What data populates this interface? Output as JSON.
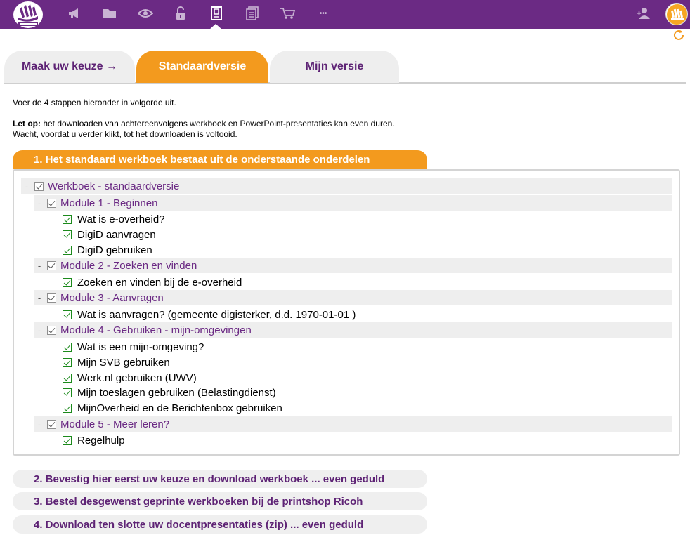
{
  "nav": {
    "icons": [
      "megaphone-icon",
      "folder-icon",
      "eye-icon",
      "unlock-icon",
      "book-icon",
      "documents-icon",
      "cart-icon",
      "more-icon"
    ],
    "more_label": "•••"
  },
  "tabs": [
    {
      "label": "Maak uw keuze →"
    },
    {
      "label": "Standaardversie"
    },
    {
      "label": "Mijn versie"
    }
  ],
  "intro": {
    "line1": "Voer de 4 stappen hieronder in volgorde uit.",
    "note_prefix": "Let op:",
    "note_text": " het downloaden van achtereenvolgens werkboek en PowerPoint-presentaties kan even duren.",
    "note_line2": "Wacht, voordat u verder klikt, tot het downloaden is voltooid."
  },
  "steps": {
    "step1": "1. Het standaard werkboek bestaat uit de onderstaande onderdelen",
    "step2": "2. Bevestig hier eerst uw keuze en download werkboek ... even geduld",
    "step3": "3. Bestel desgewenst geprinte werkboeken bij de printshop Ricoh",
    "step4": "4. Download ten slotte uw docentpresentaties (zip) ... even geduld"
  },
  "tree": {
    "toggle": "-",
    "root": "Werkboek - standaardversie",
    "modules": [
      {
        "label": "Module 1 - Beginnen",
        "items": [
          "Wat is e-overheid?",
          "DigiD aanvragen",
          "DigiD gebruiken"
        ]
      },
      {
        "label": "Module 2 - Zoeken en vinden",
        "items": [
          "Zoeken en vinden bij de e-overheid"
        ]
      },
      {
        "label": "Module 3 - Aanvragen",
        "items": [
          "Wat is aanvragen? (gemeente digisterker, d.d. 1970-01-01 )"
        ]
      },
      {
        "label": "Module 4 - Gebruiken - mijn-omgevingen",
        "items": [
          "Wat is een mijn-omgeving?",
          "Mijn SVB gebruiken",
          "Werk.nl gebruiken (UWV)",
          "Mijn toeslagen gebruiken (Belastingdienst)",
          "MijnOverheid en de Berichtenbox gebruiken"
        ]
      },
      {
        "label": "Module 5 - Meer leren?",
        "items": [
          "Regelhulp"
        ]
      }
    ]
  },
  "colors": {
    "topbar": "#6b2a84",
    "accent": "#f39a1e",
    "link": "#6b2a84",
    "check": "#1c8a1c"
  }
}
